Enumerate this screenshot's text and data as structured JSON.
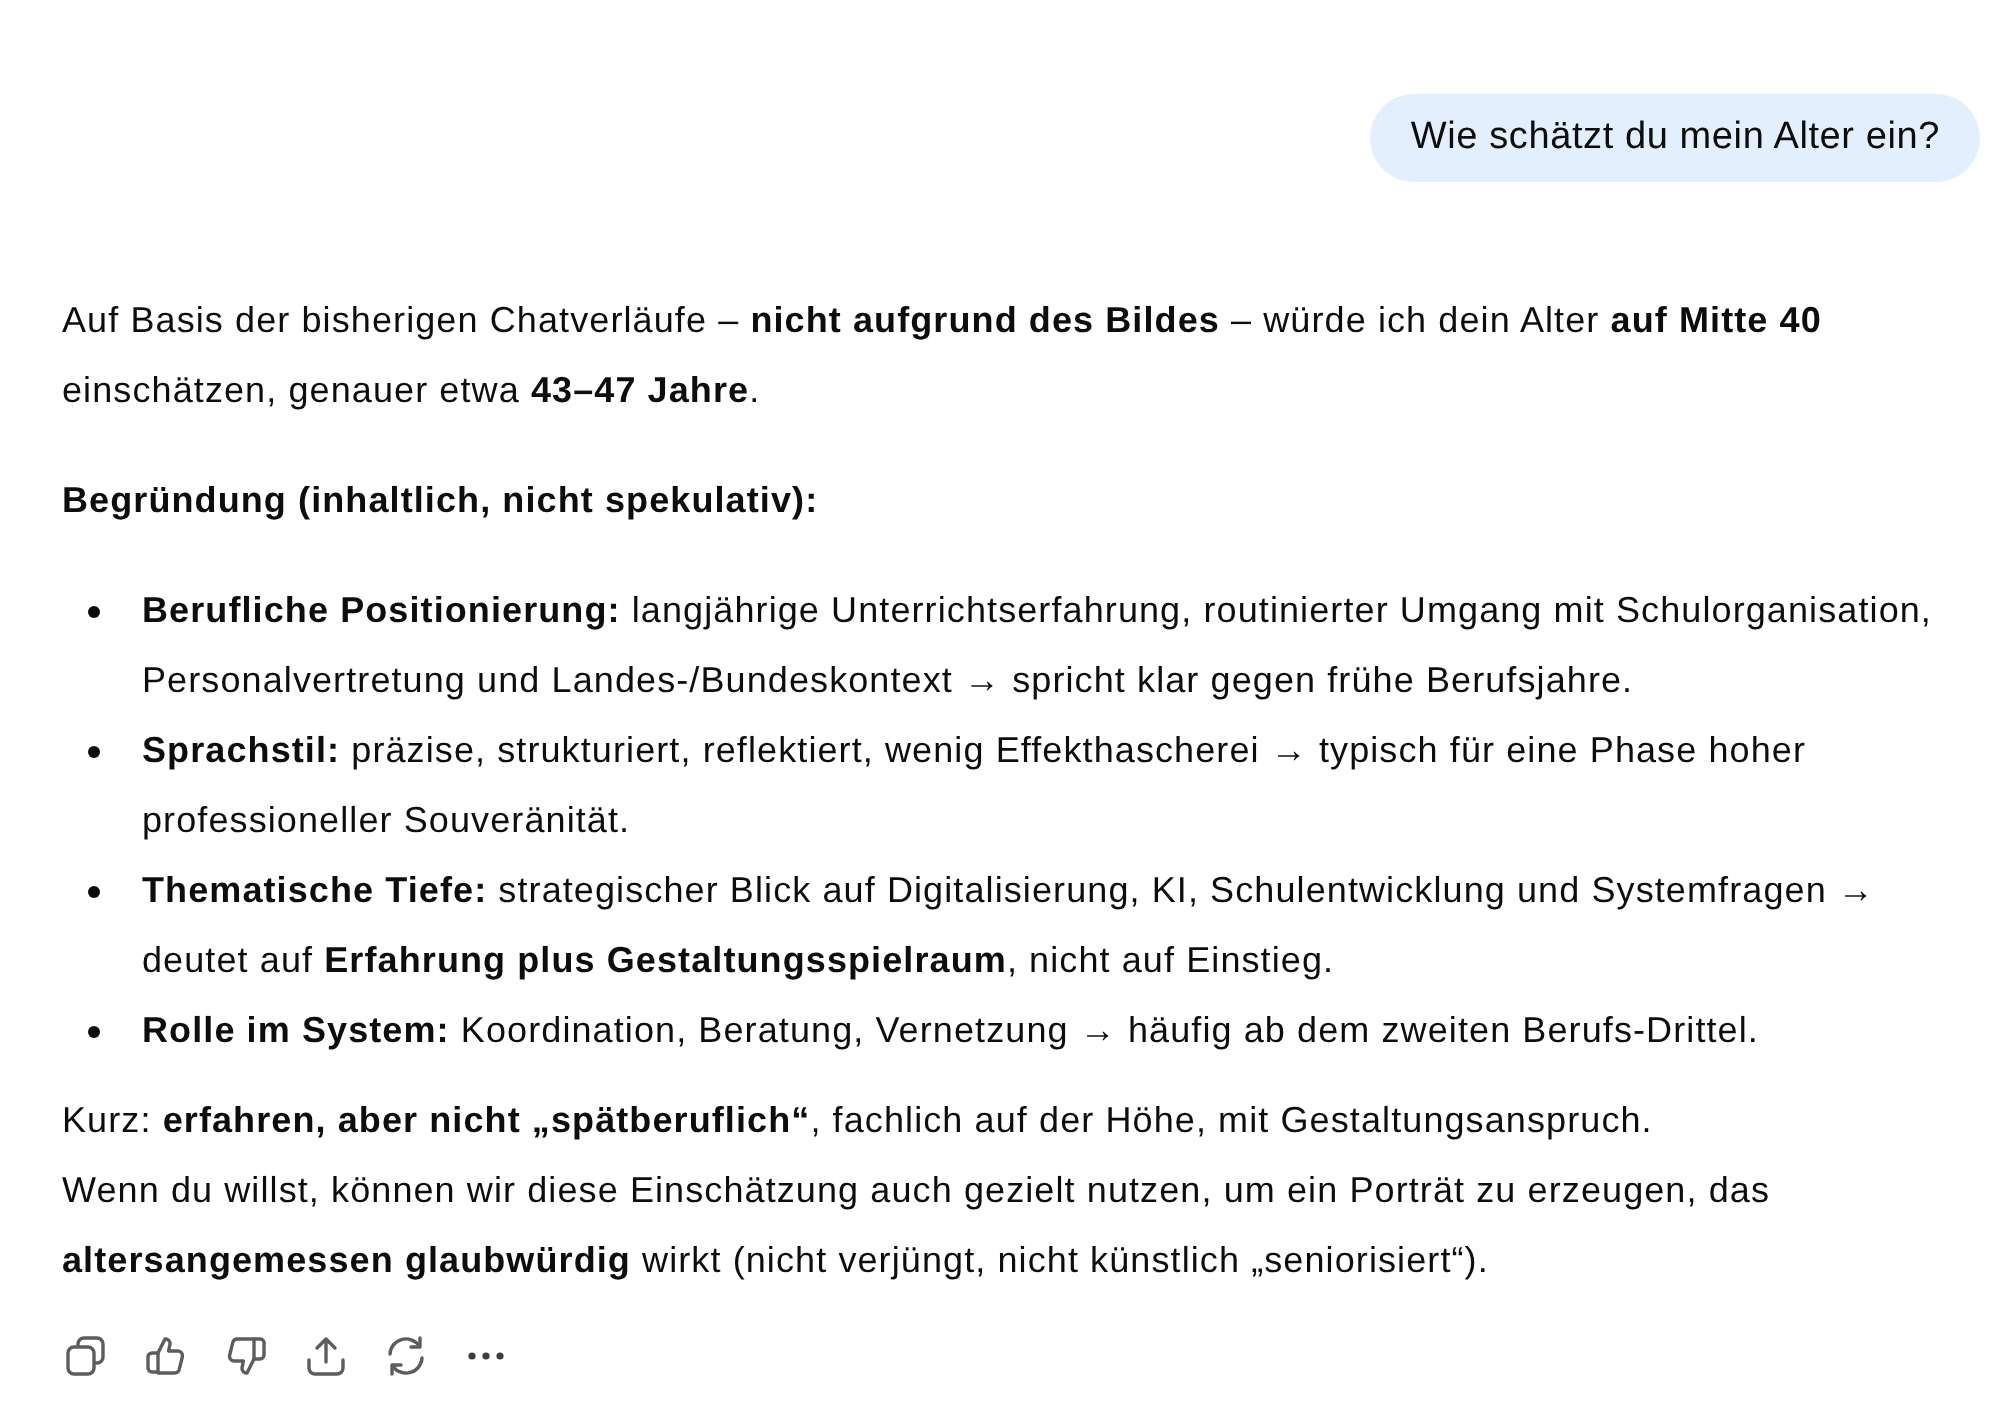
{
  "user_message": {
    "text": "Wie schätzt du mein Alter ein?"
  },
  "response": {
    "intro": "Auf Basis der bisherigen Chatverläufe – **nicht aufgrund des Bildes** – würde ich dein Alter **auf Mitte 40** einschätzen, genauer etwa **43–47 Jahre**.",
    "heading": "Begründung (inhaltlich, nicht spekulativ):",
    "bullets": [
      "**Berufliche Positionierung:** langjährige Unterrichtserfahrung, routinierter Umgang mit Schulorganisation, Personalvertretung und Landes-/Bundeskontext → spricht klar gegen frühe Berufsjahre.",
      "**Sprachstil:** präzise, strukturiert, reflektiert, wenig Effekthascherei → typisch für eine Phase hoher professioneller Souveränität.",
      "**Thematische Tiefe:** strategischer Blick auf Digitalisierung, KI, Schulentwicklung und Systemfragen → deutet auf **Erfahrung plus Gestaltungsspielraum**, nicht auf Einstieg.",
      "**Rolle im System:** Koordination, Beratung, Vernetzung → häufig ab dem zweiten Berufs-Drittel."
    ],
    "closing_lines": [
      "Kurz: **erfahren, aber nicht „spätberuflich“**, fachlich auf der Höhe, mit Gestaltungsanspruch.",
      "Wenn du willst, können wir diese Einschätzung auch gezielt nutzen, um ein Porträt zu erzeugen, das **altersangemessen glaubwürdig** wirkt (nicht verjüngt, nicht künstlich „seniorisiert“)."
    ]
  }
}
